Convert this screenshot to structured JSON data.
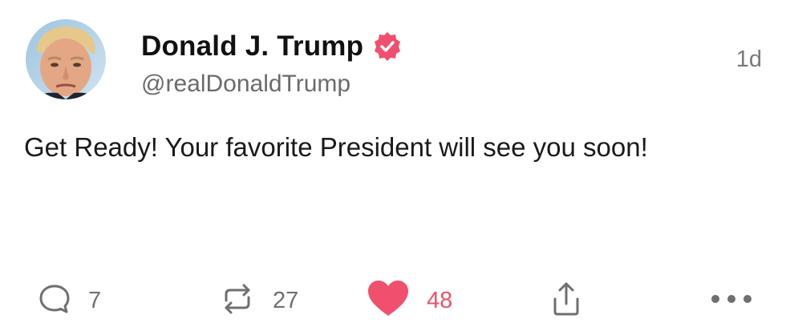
{
  "author": {
    "display_name": "Donald J. Trump",
    "handle": "@realDonaldTrump",
    "verified": true,
    "avatar": "avatar-portrait"
  },
  "timestamp": "1d",
  "body": "Get Ready! Your favorite President will see you soon!",
  "actions": {
    "reply": {
      "icon": "speech-bubble-icon",
      "count": "7"
    },
    "repost": {
      "icon": "repost-arrows-icon",
      "count": "27"
    },
    "like": {
      "icon": "heart-icon",
      "count": "48",
      "liked": true
    },
    "share": {
      "icon": "share-upload-icon"
    },
    "more": {
      "icon": "ellipsis-icon"
    }
  },
  "colors": {
    "accent": "#f0506e",
    "like_count": "#e8546b",
    "muted": "#707070",
    "text": "#111111"
  }
}
